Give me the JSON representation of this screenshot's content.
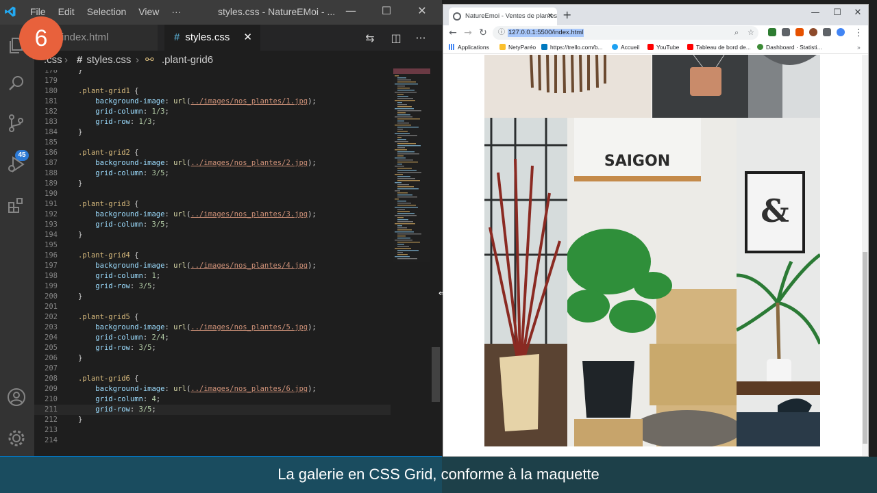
{
  "step": "6",
  "vscode": {
    "menu": [
      "File",
      "Edit",
      "Selection",
      "View",
      "···"
    ],
    "window_title": "styles.css - NatureEMoi - ...",
    "scm_badge": "45",
    "tabs": [
      {
        "label": "index.html",
        "active": false
      },
      {
        "label": "styles.css",
        "active": true
      }
    ],
    "tab_close": "✕",
    "breadcrumb": [
      ".css",
      "styles.css",
      ".plant-grid6"
    ],
    "code_lines": [
      {
        "n": "178",
        "t": "}"
      },
      {
        "n": "179",
        "t": ""
      },
      {
        "n": "180",
        "t": ".plant-grid1 {"
      },
      {
        "n": "181",
        "t": "    background-image: url(../images/nos_plantes/1.jpg);"
      },
      {
        "n": "182",
        "t": "    grid-column: 1/3;"
      },
      {
        "n": "183",
        "t": "    grid-row: 1/3;"
      },
      {
        "n": "184",
        "t": "}"
      },
      {
        "n": "185",
        "t": ""
      },
      {
        "n": "186",
        "t": ".plant-grid2 {"
      },
      {
        "n": "187",
        "t": "    background-image: url(../images/nos_plantes/2.jpg);"
      },
      {
        "n": "188",
        "t": "    grid-column: 3/5;"
      },
      {
        "n": "189",
        "t": "}"
      },
      {
        "n": "190",
        "t": ""
      },
      {
        "n": "191",
        "t": ".plant-grid3 {"
      },
      {
        "n": "192",
        "t": "    background-image: url(../images/nos_plantes/3.jpg);"
      },
      {
        "n": "193",
        "t": "    grid-column: 3/5;"
      },
      {
        "n": "194",
        "t": "}"
      },
      {
        "n": "195",
        "t": ""
      },
      {
        "n": "196",
        "t": ".plant-grid4 {"
      },
      {
        "n": "197",
        "t": "    background-image: url(../images/nos_plantes/4.jpg);"
      },
      {
        "n": "198",
        "t": "    grid-column: 1;"
      },
      {
        "n": "199",
        "t": "    grid-row: 3/5;"
      },
      {
        "n": "200",
        "t": "}"
      },
      {
        "n": "201",
        "t": ""
      },
      {
        "n": "202",
        "t": ".plant-grid5 {"
      },
      {
        "n": "203",
        "t": "    background-image: url(../images/nos_plantes/5.jpg);"
      },
      {
        "n": "204",
        "t": "    grid-column: 2/4;"
      },
      {
        "n": "205",
        "t": "    grid-row: 3/5;"
      },
      {
        "n": "206",
        "t": "}"
      },
      {
        "n": "207",
        "t": ""
      },
      {
        "n": "208",
        "t": ".plant-grid6 {"
      },
      {
        "n": "209",
        "t": "    background-image: url(../images/nos_plantes/6.jpg);"
      },
      {
        "n": "210",
        "t": "    grid-column: 4;"
      },
      {
        "n": "211",
        "t": "    grid-row: 3/5;"
      },
      {
        "n": "212",
        "t": "}"
      },
      {
        "n": "213",
        "t": ""
      },
      {
        "n": "214",
        "t": ""
      }
    ]
  },
  "chrome": {
    "tab_title": "NatureEmoi - Ventes de plantes",
    "url": "127.0.0.1:5500/index.html",
    "bookmarks": [
      "Applications",
      "NetyParéo",
      "https://trello.com/b...",
      "Accueil",
      "YouTube",
      "Tableau de bord de...",
      "Dashboard · Statisti..."
    ],
    "page_sign": "SAIGON",
    "page_amp": "&"
  },
  "caption": "La galerie en CSS Grid, conforme à la maquette",
  "colors": {
    "vscode_bg": "#1e1e1e",
    "accent_orange": "#e8613c",
    "status_blue": "#007acc",
    "caption_bg": "#1e4650"
  }
}
